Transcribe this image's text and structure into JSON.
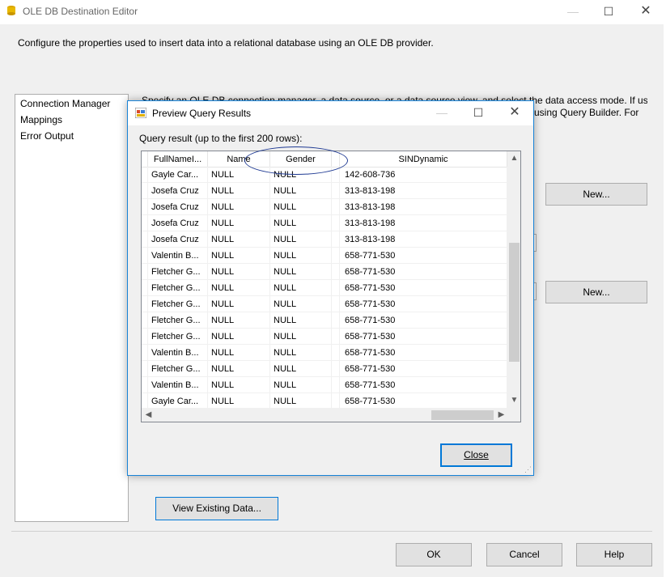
{
  "main_window": {
    "title": "OLE DB Destination Editor",
    "description": "Configure the properties used to insert data into a relational database using an OLE DB provider.",
    "nav_items": [
      {
        "label": "Connection Manager"
      },
      {
        "label": "Mappings"
      },
      {
        "label": "Error Output"
      }
    ],
    "right_desc_line1": "Specify an OLE DB connection manager, a data source, or a data source view, and select the data access mode. If using",
    "right_desc_line2": "using Query Builder. For",
    "new_button_1": "New...",
    "new_button_2": "New...",
    "view_existing_button": "View Existing Data...",
    "ok_button": "OK",
    "cancel_button": "Cancel",
    "help_button": "Help"
  },
  "dialog": {
    "title": "Preview Query Results",
    "label": "Query result (up to the first 200 rows):",
    "close_button": "Close",
    "columns": [
      "FullNameI...",
      "Name",
      "Gender",
      "SINDynamic"
    ],
    "rows": [
      [
        "Gayle Car...",
        "NULL",
        "NULL",
        "142-608-736"
      ],
      [
        "Josefa Cruz",
        "NULL",
        "NULL",
        "313-813-198"
      ],
      [
        "Josefa Cruz",
        "NULL",
        "NULL",
        "313-813-198"
      ],
      [
        "Josefa Cruz",
        "NULL",
        "NULL",
        "313-813-198"
      ],
      [
        "Josefa Cruz",
        "NULL",
        "NULL",
        "313-813-198"
      ],
      [
        "Valentin B...",
        "NULL",
        "NULL",
        "658-771-530"
      ],
      [
        "Fletcher G...",
        "NULL",
        "NULL",
        "658-771-530"
      ],
      [
        "Fletcher G...",
        "NULL",
        "NULL",
        "658-771-530"
      ],
      [
        "Fletcher G...",
        "NULL",
        "NULL",
        "658-771-530"
      ],
      [
        "Fletcher G...",
        "NULL",
        "NULL",
        "658-771-530"
      ],
      [
        "Fletcher G...",
        "NULL",
        "NULL",
        "658-771-530"
      ],
      [
        "Valentin B...",
        "NULL",
        "NULL",
        "658-771-530"
      ],
      [
        "Fletcher G...",
        "NULL",
        "NULL",
        "658-771-530"
      ],
      [
        "Valentin B...",
        "NULL",
        "NULL",
        "658-771-530"
      ],
      [
        "Gayle Car...",
        "NULL",
        "NULL",
        "658-771-530"
      ]
    ]
  },
  "colors": {
    "accent": "#0078d7",
    "annotation_ellipse": "#1f3a93"
  }
}
